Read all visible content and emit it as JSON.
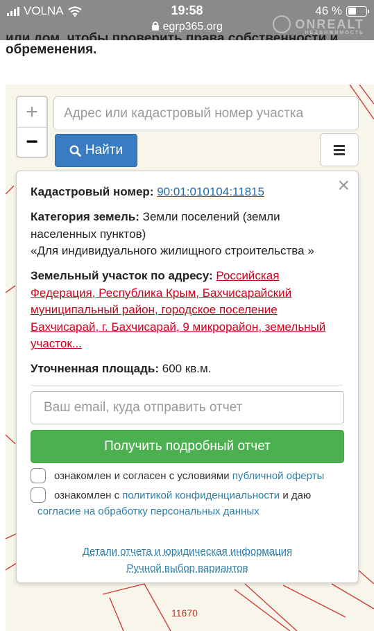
{
  "status_bar": {
    "carrier": "VOLNA",
    "time": "19:58",
    "battery": "46 %",
    "battery_level": 0.46,
    "url": "egrp365.org",
    "watermark": "ONREALT",
    "watermark_sub": "НЕДВИЖИМОСТЬ"
  },
  "page": {
    "heading_cut": "или дом, чтобы проверить права собственности и",
    "heading_line2": "обременения."
  },
  "map": {
    "zoom_in": "+",
    "zoom_out": "−",
    "search_placeholder": "Адрес или кадастровый номер участка",
    "find_button": "Найти",
    "parcel_label": "11670"
  },
  "card": {
    "close": "×",
    "cadastral_label": "Кадастровый номер:",
    "cadastral_number": "90:01:010104:11815",
    "category_label": "Категория земель:",
    "category_value": "Земли поселений (земли населенных пунктов)",
    "category_use": "«Для индивидуального жилищного строительства »",
    "address_label": "Земельный участок по адресу:",
    "address_value": "Российская Федерация, Республика Крым, Бахчисарайский муниципальный район, городское поселение Бахчисарай, г. Бахчисарай, 9 микрорайон, земельный участок...",
    "area_label": "Уточненная площадь:",
    "area_value": "600 кв.м.",
    "email_placeholder": "Ваш email, куда отправить отчет",
    "report_button": "Получить подробный отчет",
    "consent1_text": "ознакомлен и согласен с условиями",
    "consent1_link": "публичной оферты",
    "consent2_text": "ознакомлен с",
    "consent2_link": "политикой конфиденциальности",
    "consent2_mid": "и даю",
    "consent2_link2": "согласие на обработку персональных данных",
    "details_link": "Детали отчета и юридическая информация",
    "manual_link": "Ручной выбор вариантов"
  }
}
